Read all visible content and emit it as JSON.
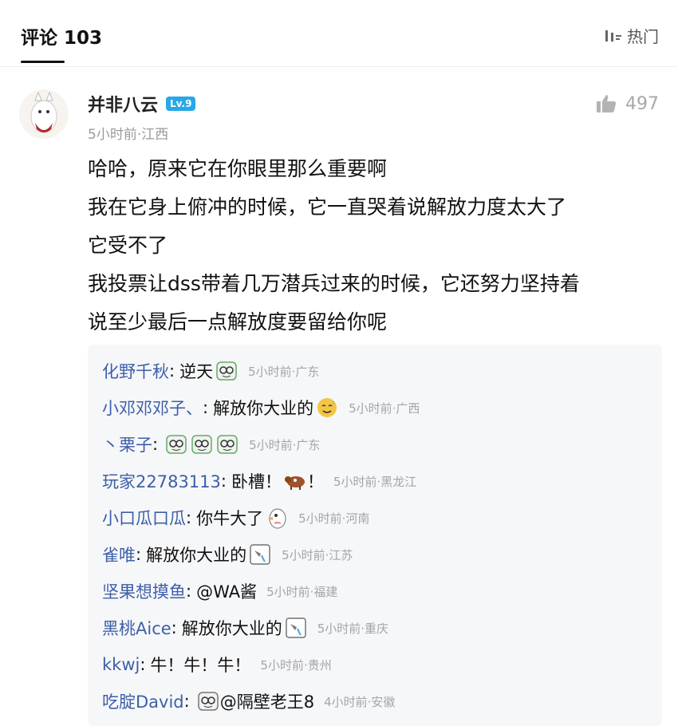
{
  "header": {
    "title": "评论 103",
    "sort_label": "热门"
  },
  "comment": {
    "username": "并非八云",
    "level": "Lv.9",
    "time_location": "5小时前·江西",
    "like_count": "497",
    "lines": [
      "哈哈，原来它在你眼里那么重要啊",
      "我在它身上俯冲的时候，它一直哭着说解放力度太大了",
      "它受不了",
      "我投票让dss带着几万潜兵过来的时候，它还努力坚持着",
      "说至少最后一点解放度要留给你呢"
    ]
  },
  "replies": [
    {
      "user": "化野千秋",
      "text": "逆天",
      "emoji": "glasses-face",
      "meta": "5小时前·广东"
    },
    {
      "user": "小邓邓邓子、",
      "text": "解放你大业的",
      "emoji": "sweat-face",
      "meta": "5小时前·广西"
    },
    {
      "user": "丶栗子",
      "text": "",
      "emoji": "glasses-face-x3",
      "meta": "5小时前·广东"
    },
    {
      "user": "玩家22783113",
      "text": "卧槽！",
      "text2": "！",
      "emoji": "cow",
      "meta": "5小时前·黑龙江"
    },
    {
      "user": "小口瓜口瓜",
      "text": "你牛大了",
      "emoji": "bird-face",
      "meta": "5小时前·河南"
    },
    {
      "user": "雀唯",
      "text": "解放你大业的",
      "emoji": "pouring-icon",
      "meta": "5小时前·江苏"
    },
    {
      "user": "坚果想摸鱼",
      "text": "@WA酱",
      "emoji": "",
      "meta": "5小时前·福建"
    },
    {
      "user": "黑桃Aice",
      "text": "解放你大业的",
      "emoji": "pouring-icon",
      "meta": "5小时前·重庆"
    },
    {
      "user": "kkwj",
      "text": "牛！牛！牛！",
      "emoji": "",
      "meta": "5小时前·贵州"
    },
    {
      "user": "吃腚David",
      "text": "@隔壁老王8",
      "emoji": "glasses-face",
      "meta": "4小时前·安徽"
    }
  ]
}
